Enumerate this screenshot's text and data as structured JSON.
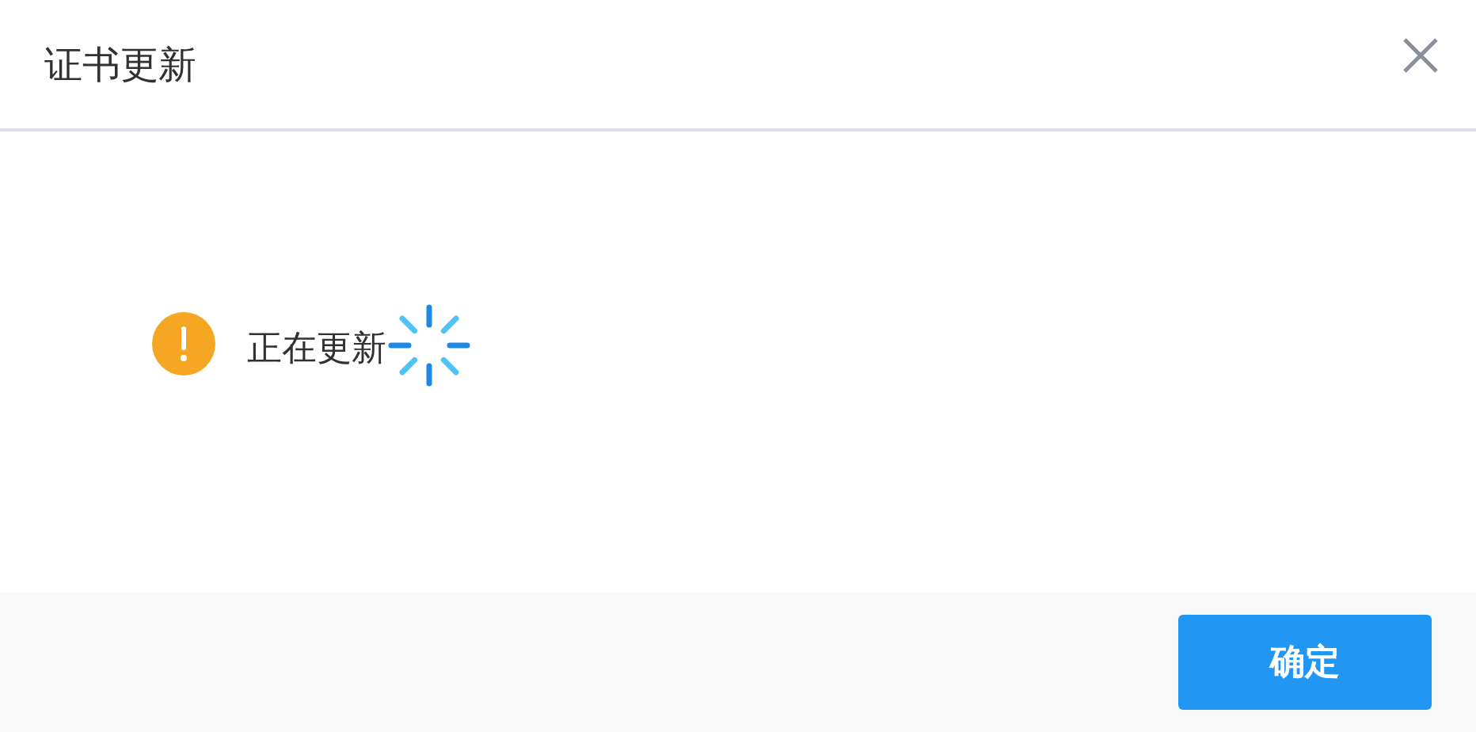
{
  "dialog": {
    "title": "证书更新",
    "message": "正在更新",
    "loading": true,
    "buttons": [
      {
        "label": "确定"
      }
    ]
  }
}
